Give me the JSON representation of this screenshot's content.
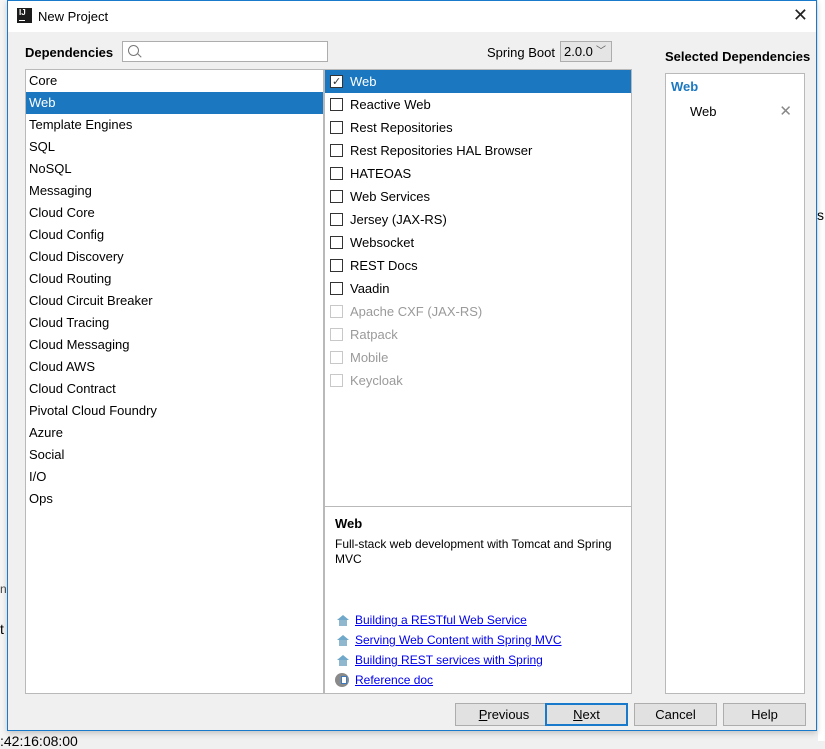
{
  "background": {
    "partial_texts": [
      "n",
      "t",
      "s",
      ":42:16:08:00"
    ]
  },
  "window": {
    "title": "New Project",
    "app_icon": "intellij-icon",
    "close_icon": "close-icon"
  },
  "header": {
    "dependencies_label": "Dependencies",
    "search": {
      "value": "",
      "placeholder": ""
    },
    "spring_boot_label": "Spring Boot",
    "spring_boot_version": "2.0.0",
    "selected_dependencies_label": "Selected Dependencies"
  },
  "categories": [
    {
      "label": "Core",
      "selected": false
    },
    {
      "label": "Web",
      "selected": true
    },
    {
      "label": "Template Engines",
      "selected": false
    },
    {
      "label": "SQL",
      "selected": false
    },
    {
      "label": "NoSQL",
      "selected": false
    },
    {
      "label": "Messaging",
      "selected": false
    },
    {
      "label": "Cloud Core",
      "selected": false
    },
    {
      "label": "Cloud Config",
      "selected": false
    },
    {
      "label": "Cloud Discovery",
      "selected": false
    },
    {
      "label": "Cloud Routing",
      "selected": false
    },
    {
      "label": "Cloud Circuit Breaker",
      "selected": false
    },
    {
      "label": "Cloud Tracing",
      "selected": false
    },
    {
      "label": "Cloud Messaging",
      "selected": false
    },
    {
      "label": "Cloud AWS",
      "selected": false
    },
    {
      "label": "Cloud Contract",
      "selected": false
    },
    {
      "label": "Pivotal Cloud Foundry",
      "selected": false
    },
    {
      "label": "Azure",
      "selected": false
    },
    {
      "label": "Social",
      "selected": false
    },
    {
      "label": "I/O",
      "selected": false
    },
    {
      "label": "Ops",
      "selected": false
    }
  ],
  "dependencies": [
    {
      "label": "Web",
      "checked": true,
      "enabled": true,
      "highlighted": true
    },
    {
      "label": "Reactive Web",
      "checked": false,
      "enabled": true,
      "highlighted": false
    },
    {
      "label": "Rest Repositories",
      "checked": false,
      "enabled": true,
      "highlighted": false
    },
    {
      "label": "Rest Repositories HAL Browser",
      "checked": false,
      "enabled": true,
      "highlighted": false
    },
    {
      "label": "HATEOAS",
      "checked": false,
      "enabled": true,
      "highlighted": false
    },
    {
      "label": "Web Services",
      "checked": false,
      "enabled": true,
      "highlighted": false
    },
    {
      "label": "Jersey (JAX-RS)",
      "checked": false,
      "enabled": true,
      "highlighted": false
    },
    {
      "label": "Websocket",
      "checked": false,
      "enabled": true,
      "highlighted": false
    },
    {
      "label": "REST Docs",
      "checked": false,
      "enabled": true,
      "highlighted": false
    },
    {
      "label": "Vaadin",
      "checked": false,
      "enabled": true,
      "highlighted": false
    },
    {
      "label": "Apache CXF (JAX-RS)",
      "checked": false,
      "enabled": false,
      "highlighted": false
    },
    {
      "label": "Ratpack",
      "checked": false,
      "enabled": false,
      "highlighted": false
    },
    {
      "label": "Mobile",
      "checked": false,
      "enabled": false,
      "highlighted": false
    },
    {
      "label": "Keycloak",
      "checked": false,
      "enabled": false,
      "highlighted": false
    }
  ],
  "description": {
    "title": "Web",
    "text": "Full-stack web development with Tomcat and Spring MVC",
    "links": [
      {
        "label": "Building a RESTful Web Service",
        "icon": "guide-house-icon"
      },
      {
        "label": "Serving Web Content with Spring MVC",
        "icon": "guide-house-icon"
      },
      {
        "label": "Building REST services with Spring",
        "icon": "guide-house-icon"
      },
      {
        "label": "Reference doc",
        "icon": "reference-doc-icon"
      }
    ]
  },
  "selected": {
    "groups": [
      {
        "name": "Web",
        "items": [
          "Web"
        ]
      }
    ]
  },
  "buttons": {
    "previous": {
      "mnemonic": "P",
      "rest": "revious"
    },
    "next": {
      "mnemonic": "N",
      "rest": "ext"
    },
    "cancel": "Cancel",
    "help": "Help"
  },
  "colors": {
    "accent": "#1b78c0",
    "window_border": "#1979ca",
    "link": "#0000ee"
  }
}
